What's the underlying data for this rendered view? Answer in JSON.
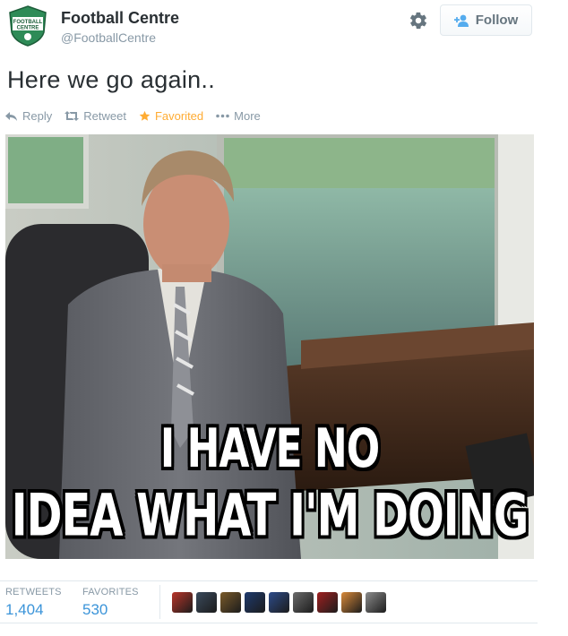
{
  "account": {
    "name": "Football Centre",
    "handle": "@FootballCentre",
    "avatar_text_1": "FOOTBALL",
    "avatar_text_2": "CENTRE",
    "avatar_color": "#2e8b57"
  },
  "follow_button": {
    "label": "Follow",
    "icon": "add-user-icon"
  },
  "settings_icon": "gear-icon",
  "tweet": {
    "text": "Here we go again.."
  },
  "actions": [
    {
      "label": "Reply",
      "icon": "reply-icon"
    },
    {
      "label": "Retweet",
      "icon": "retweet-icon"
    },
    {
      "label": "Favorited",
      "icon": "star-icon",
      "color": "#ffac33"
    },
    {
      "label": "More",
      "icon": "ellipsis-icon"
    }
  ],
  "media": {
    "caption_line_1": "I HAVE NO",
    "caption_line_2": "IDEA WHAT I'M DOING"
  },
  "stats": {
    "retweets_label": "RETWEETS",
    "retweets_value": "1,404",
    "favorites_label": "FAVORITES",
    "favorites_value": "530"
  },
  "favoriters": [
    "#b9352a",
    "#3a4a5c",
    "#7a5a2a",
    "#1e3a6e",
    "#2d4b8a",
    "#6b6b6b",
    "#a02020",
    "#d98a3a",
    "#8c8c8c"
  ]
}
